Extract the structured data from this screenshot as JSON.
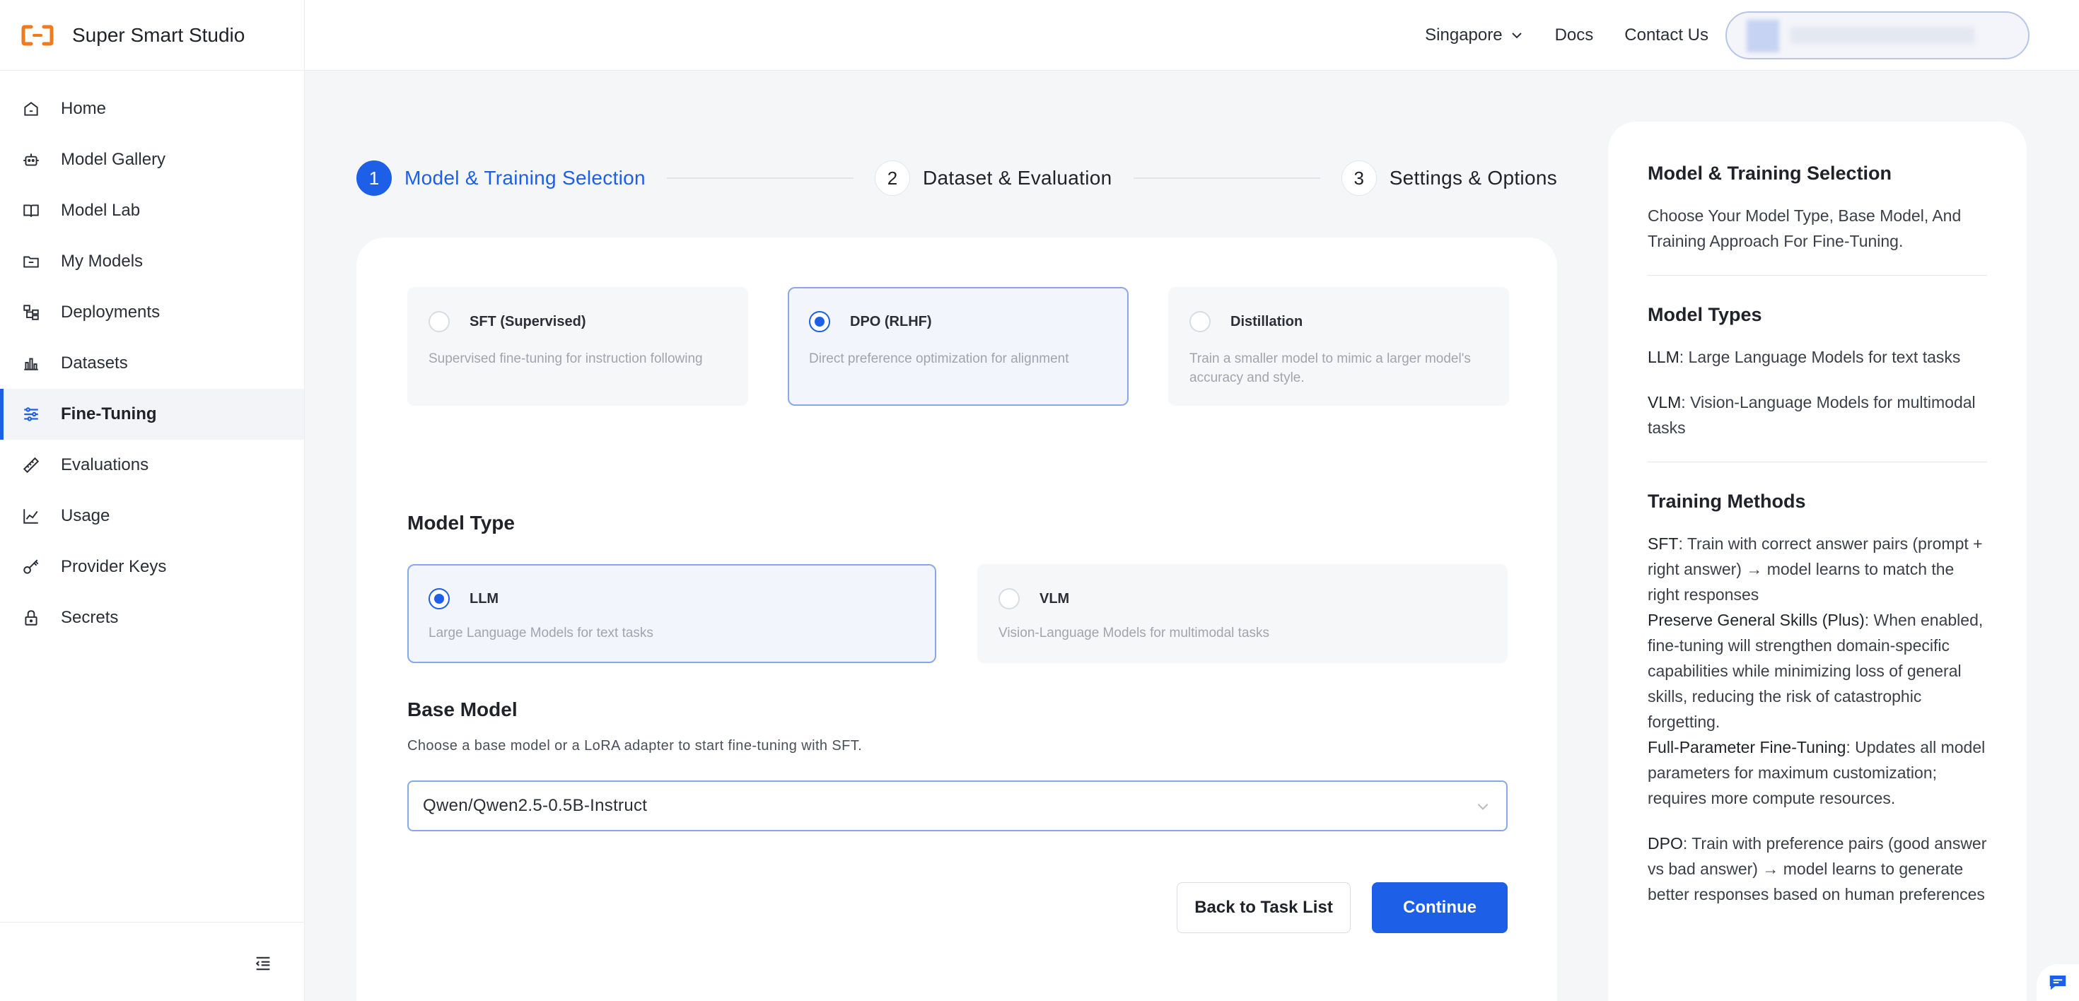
{
  "brand": {
    "name": "Super Smart Studio",
    "accent": "#f27a1a"
  },
  "sidebar": {
    "items": [
      {
        "label": "Home",
        "icon": "home-icon"
      },
      {
        "label": "Model Gallery",
        "icon": "robot-icon"
      },
      {
        "label": "Model Lab",
        "icon": "book-icon"
      },
      {
        "label": "My Models",
        "icon": "folder-icon"
      },
      {
        "label": "Deployments",
        "icon": "deploy-icon"
      },
      {
        "label": "Datasets",
        "icon": "bar-chart-icon"
      },
      {
        "label": "Fine-Tuning",
        "icon": "sliders-icon",
        "active": true
      },
      {
        "label": "Evaluations",
        "icon": "ruler-icon"
      },
      {
        "label": "Usage",
        "icon": "usage-chart-icon"
      },
      {
        "label": "Provider Keys",
        "icon": "key-icon"
      },
      {
        "label": "Secrets",
        "icon": "lock-icon"
      }
    ]
  },
  "topbar": {
    "region": "Singapore",
    "docs": "Docs",
    "contact": "Contact Us"
  },
  "stepper": {
    "steps": [
      {
        "num": "1",
        "label": "Model & Training Selection",
        "active": true
      },
      {
        "num": "2",
        "label": "Dataset & Evaluation"
      },
      {
        "num": "3",
        "label": "Settings & Options"
      }
    ]
  },
  "methods": [
    {
      "title": "SFT (Supervised)",
      "desc": "Supervised fine-tuning for instruction following",
      "selected": false
    },
    {
      "title": "DPO (RLHF)",
      "desc": "Direct preference optimization for alignment",
      "selected": true
    },
    {
      "title": "Distillation",
      "desc": "Train a smaller model to mimic a larger model's accuracy and style.",
      "selected": false
    }
  ],
  "model_type": {
    "title": "Model Type",
    "options": [
      {
        "title": "LLM",
        "desc": "Large Language Models for text tasks",
        "selected": true
      },
      {
        "title": "VLM",
        "desc": "Vision-Language Models for multimodal tasks",
        "selected": false
      }
    ]
  },
  "base_model": {
    "title": "Base Model",
    "subtitle": "Choose a base model or a LoRA adapter to start fine-tuning with SFT.",
    "value": "Qwen/Qwen2.5-0.5B-Instruct"
  },
  "actions": {
    "back": "Back to Task List",
    "continue": "Continue"
  },
  "help": {
    "title1": "Model & Training Selection",
    "desc1": "Choose Your Model Type, Base Model, And Training Approach For Fine-Tuning.",
    "title2": "Model Types",
    "llm_term": "LLM",
    "llm_text": ": Large Language Models for text tasks",
    "vlm_term": "VLM",
    "vlm_text": ": Vision-Language Models for multimodal tasks",
    "title3": "Training Methods",
    "sft_term": "SFT",
    "sft_text": ": Train with correct answer pairs (prompt + right answer) → model learns to match the right responses",
    "pgs_term": "Preserve General Skills (Plus)",
    "pgs_text": ": When enabled, fine-tuning will strengthen domain-specific capabilities while minimizing loss of general skills, reducing the risk of catastrophic forgetting.",
    "fpft_term": "Full-Parameter Fine-Tuning",
    "fpft_text": ": Updates all model parameters for maximum customization; requires more compute resources.",
    "dpo_term": "DPO",
    "dpo_text": ": Train with preference pairs (good answer vs bad answer) → model learns to generate better responses based on human preferences"
  },
  "colors": {
    "primary": "#1d5fe6",
    "selected_border": "#88a8ea"
  }
}
